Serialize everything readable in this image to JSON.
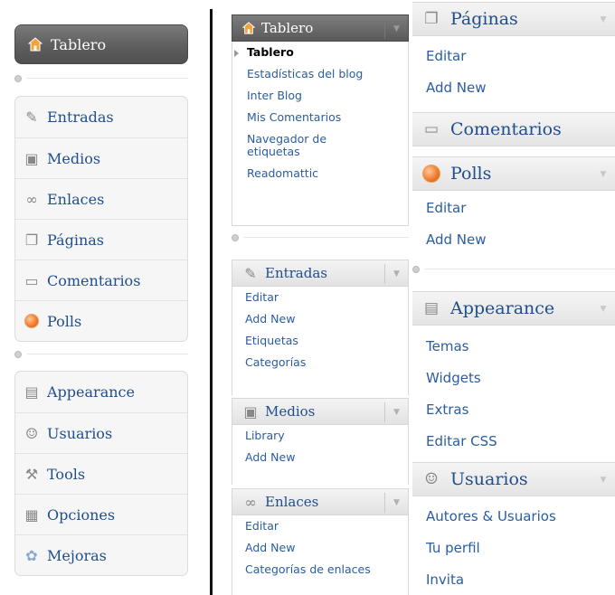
{
  "col1": {
    "dashboard": {
      "label": "Tablero"
    },
    "group1": [
      {
        "label": "Entradas",
        "icon": "pin-icon"
      },
      {
        "label": "Medios",
        "icon": "media-icon"
      },
      {
        "label": "Enlaces",
        "icon": "link-icon"
      },
      {
        "label": "Páginas",
        "icon": "pages-icon"
      },
      {
        "label": "Comentarios",
        "icon": "comments-icon"
      },
      {
        "label": "Polls",
        "icon": "polls-icon"
      }
    ],
    "group2": [
      {
        "label": "Appearance",
        "icon": "appearance-icon"
      },
      {
        "label": "Usuarios",
        "icon": "users-icon"
      },
      {
        "label": "Tools",
        "icon": "tools-icon"
      },
      {
        "label": "Opciones",
        "icon": "settings-icon"
      },
      {
        "label": "Mejoras",
        "icon": "plugins-icon"
      }
    ]
  },
  "col2": {
    "tablero": {
      "label": "Tablero",
      "items": [
        "Tablero",
        "Estadísticas del blog",
        "Inter Blog",
        "Mis Comentarios",
        "Navegador de etiquetas",
        "Readomattic"
      ]
    },
    "entradas": {
      "label": "Entradas",
      "items": [
        "Editar",
        "Add New",
        "Etiquetas",
        "Categorías"
      ]
    },
    "medios": {
      "label": "Medios",
      "items": [
        "Library",
        "Add New"
      ]
    },
    "enlaces": {
      "label": "Enlaces",
      "items": [
        "Editar",
        "Add New",
        "Categorías de enlaces"
      ]
    }
  },
  "col3": {
    "paginas": {
      "label": "Páginas",
      "items": [
        "Editar",
        "Add New"
      ]
    },
    "comentarios": {
      "label": "Comentarios"
    },
    "polls": {
      "label": "Polls",
      "items": [
        "Editar",
        "Add New"
      ]
    },
    "appearance": {
      "label": "Appearance",
      "items": [
        "Temas",
        "Widgets",
        "Extras",
        "Editar CSS"
      ]
    },
    "usuarios": {
      "label": "Usuarios",
      "items": [
        "Autores & Usuarios",
        "Tu perfil",
        "Invita"
      ]
    }
  },
  "colors": {
    "link": "#2a5d9f",
    "heading_blue": "#1f4e8c",
    "active_bg": "#5e5e5e"
  }
}
